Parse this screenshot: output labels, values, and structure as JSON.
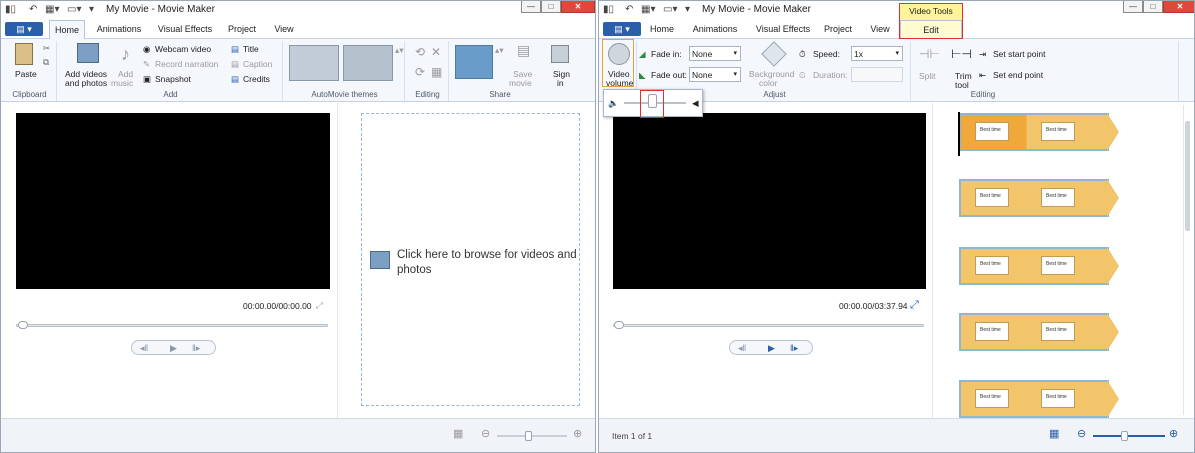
{
  "left_window": {
    "title": "My Movie - Movie Maker",
    "tabs": [
      "Home",
      "Animations",
      "Visual Effects",
      "Project",
      "View"
    ],
    "active_tab": "Home",
    "groups": {
      "clipboard": {
        "label": "Clipboard",
        "paste": "Paste"
      },
      "add": {
        "label": "Add",
        "add_videos": "Add videos",
        "and_photos": "and photos",
        "add_music": "Add",
        "add_music2": "music",
        "webcam": "Webcam video",
        "record": "Record narration",
        "snapshot": "Snapshot",
        "title": "Title",
        "caption": "Caption",
        "credits": "Credits"
      },
      "themes": {
        "label": "AutoMovie themes"
      },
      "editing": {
        "label": "Editing"
      },
      "share": {
        "label": "Share",
        "save_movie": "Save",
        "save_movie2": "movie",
        "sign_in": "Sign",
        "sign_in2": "in"
      }
    },
    "time": "00:00.00/00:00.00",
    "browse_text_1": "Click here to browse for videos and",
    "browse_text_2": "photos"
  },
  "right_window": {
    "title": "My Movie - Movie Maker",
    "contextual_tab_group": "Video Tools",
    "tabs": [
      "Home",
      "Animations",
      "Visual Effects",
      "Project",
      "View",
      "Edit"
    ],
    "active_tab": "Edit",
    "groups": {
      "audio": {
        "video_volume": "Video",
        "video_volume2": "volume"
      },
      "adjust": {
        "label": "Adjust",
        "fade_in": "Fade in:",
        "fade_in_value": "None",
        "fade_out": "Fade out:",
        "fade_out_value": "None",
        "background": "Background",
        "background2": "color",
        "speed": "Speed:",
        "speed_value": "1x",
        "duration": "Duration:"
      },
      "editing": {
        "label": "Editing",
        "split": "Split",
        "trim": "Trim",
        "trim2": "tool",
        "start": "Set start point",
        "end": "Set end point"
      }
    },
    "volume_level": 0.45,
    "time": "00:00.00/03:37.94",
    "status": "Item 1 of 1",
    "clip_thumb_text": "Best time"
  },
  "colors": {
    "accent": "#2a5faa",
    "highlight": "#e03030",
    "contextual": "#fff39a",
    "clip": "#f2c56a"
  }
}
